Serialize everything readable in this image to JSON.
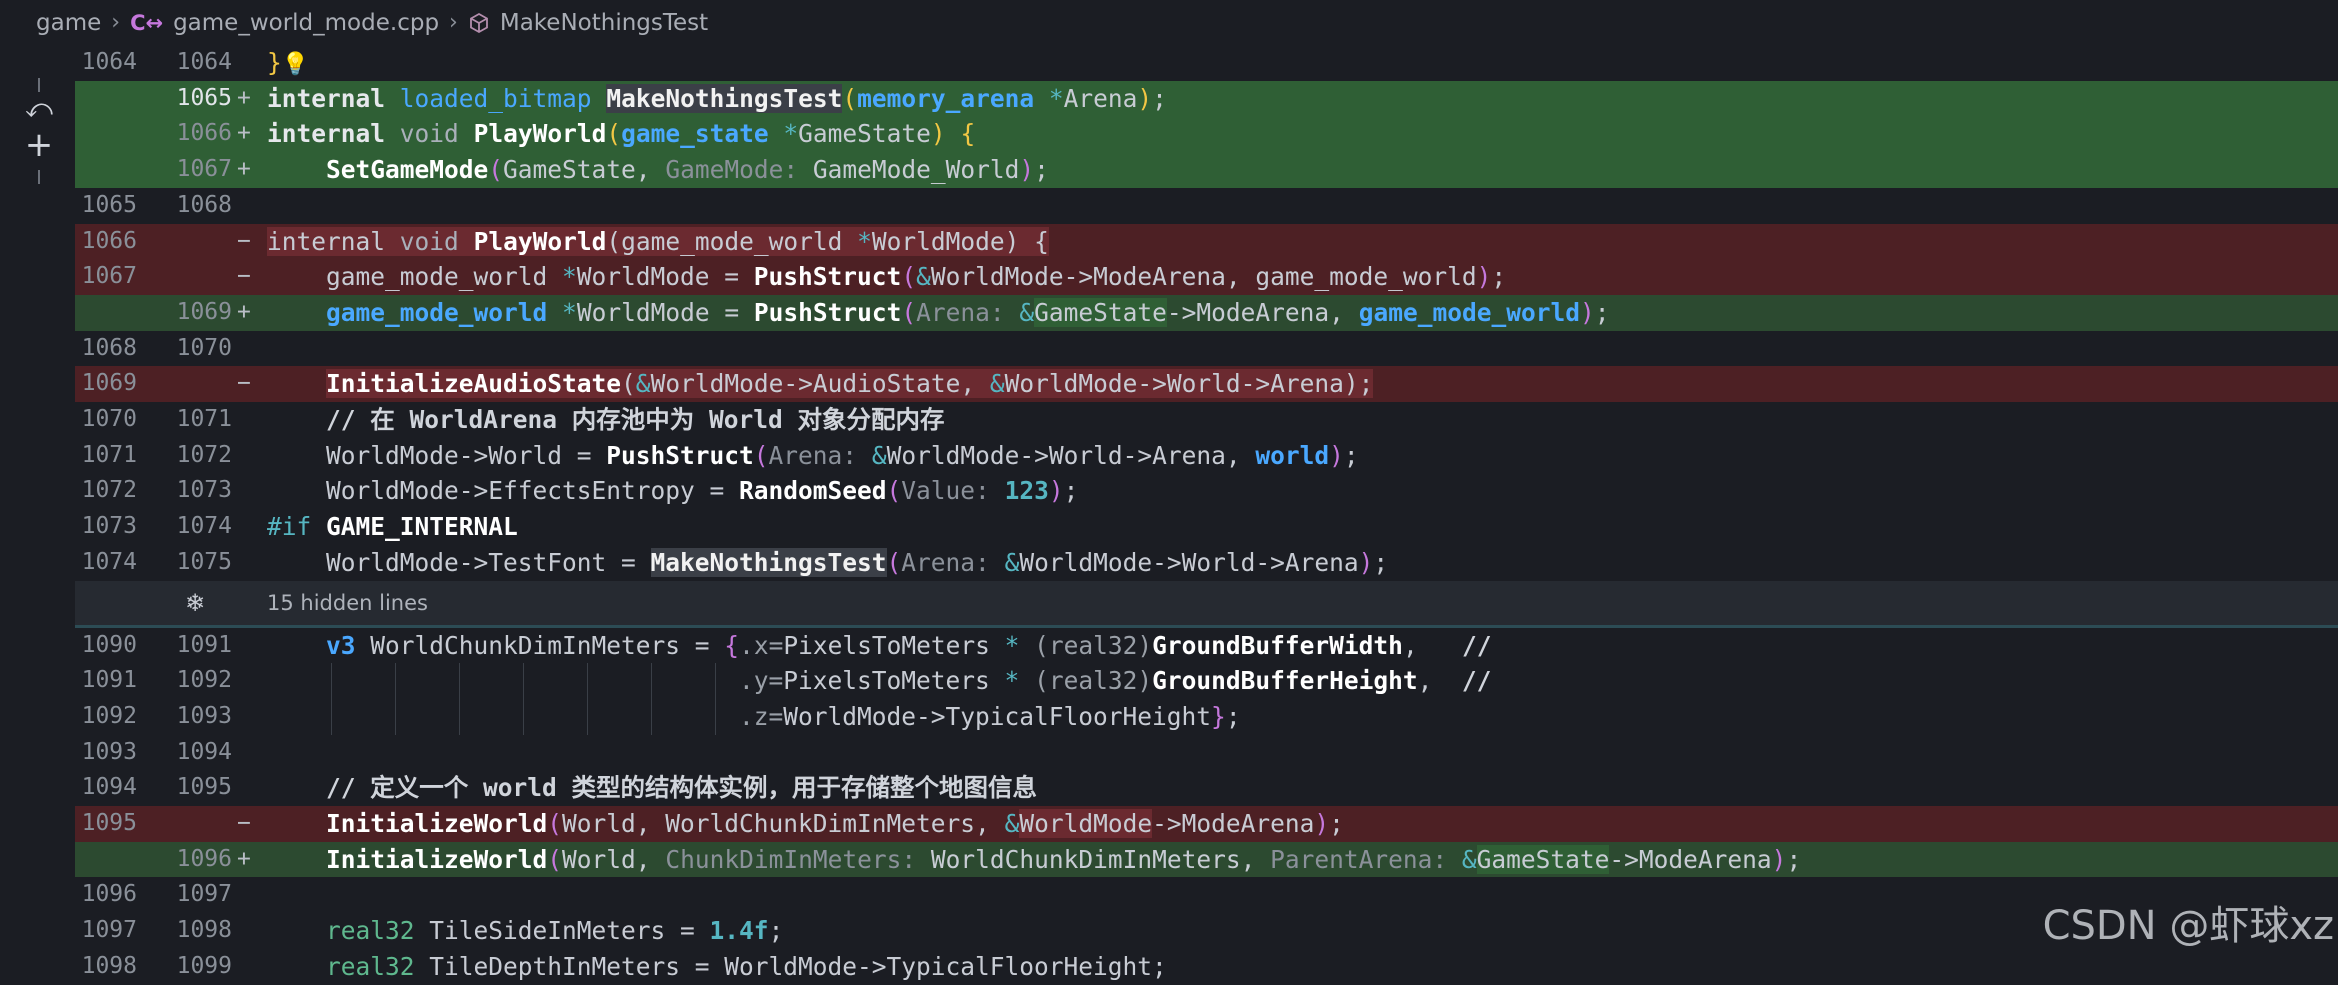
{
  "breadcrumb": {
    "root": "game",
    "file": "game_world_mode.cpp",
    "symbol": "MakeNothingsTest",
    "file_icon": "cpp-file-icon",
    "symbol_icon": "cube-icon"
  },
  "diff": {
    "hidden_lines_label": "15 hidden lines",
    "watermark": "CSDN @虾球xz",
    "lines": [
      {
        "old": "1064",
        "new": "1064",
        "mark": "",
        "text": "}"
      },
      {
        "old": "",
        "new": "1065",
        "mark": "+",
        "text": "internal loaded_bitmap MakeNothingsTest(memory_arena *Arena);"
      },
      {
        "old": "",
        "new": "1066",
        "mark": "+",
        "text": "internal void PlayWorld(game_state *GameState) {"
      },
      {
        "old": "",
        "new": "1067",
        "mark": "+",
        "text": "    SetGameMode(GameState, GameMode: GameMode_World);"
      },
      {
        "old": "1065",
        "new": "1068",
        "mark": "",
        "text": ""
      },
      {
        "old": "1066",
        "new": "",
        "mark": "−",
        "text": "internal void PlayWorld(game_mode_world *WorldMode) {"
      },
      {
        "old": "1067",
        "new": "",
        "mark": "−",
        "text": "    game_mode_world *WorldMode = PushStruct(&WorldMode->ModeArena, game_mode_world);"
      },
      {
        "old": "",
        "new": "1069",
        "mark": "+",
        "text": "    game_mode_world *WorldMode = PushStruct(Arena: &GameState->ModeArena, game_mode_world);"
      },
      {
        "old": "1068",
        "new": "1070",
        "mark": "",
        "text": ""
      },
      {
        "old": "1069",
        "new": "",
        "mark": "−",
        "text": "    InitializeAudioState(&WorldMode->AudioState, &WorldMode->World->Arena);"
      },
      {
        "old": "1070",
        "new": "1071",
        "mark": "",
        "text": "    // 在 WorldArena 内存池中为 World 对象分配内存"
      },
      {
        "old": "1071",
        "new": "1072",
        "mark": "",
        "text": "    WorldMode->World = PushStruct(Arena: &WorldMode->World->Arena, world);"
      },
      {
        "old": "1072",
        "new": "1073",
        "mark": "",
        "text": "    WorldMode->EffectsEntropy = RandomSeed(Value: 123);"
      },
      {
        "old": "1073",
        "new": "1074",
        "mark": "",
        "text": "#if GAME_INTERNAL"
      },
      {
        "old": "1074",
        "new": "1075",
        "mark": "",
        "text": "    WorldMode->TestFont = MakeNothingsTest(Arena: &WorldMode->World->Arena);"
      },
      {
        "old": "1090",
        "new": "1091",
        "mark": "",
        "text": "    v3 WorldChunkDimInMeters = {.x=PixelsToMeters * (real32)GroundBufferWidth,   //"
      },
      {
        "old": "1091",
        "new": "1092",
        "mark": "",
        "text": "                                .y=PixelsToMeters * (real32)GroundBufferHeight,  //"
      },
      {
        "old": "1092",
        "new": "1093",
        "mark": "",
        "text": "                                .z=WorldMode->TypicalFloorHeight};"
      },
      {
        "old": "1093",
        "new": "1094",
        "mark": "",
        "text": ""
      },
      {
        "old": "1094",
        "new": "1095",
        "mark": "",
        "text": "    // 定义一个 world 类型的结构体实例，用于存储整个地图信息"
      },
      {
        "old": "1095",
        "new": "",
        "mark": "−",
        "text": "    InitializeWorld(World, WorldChunkDimInMeters, &WorldMode->ModeArena);"
      },
      {
        "old": "",
        "new": "1096",
        "mark": "+",
        "text": "    InitializeWorld(World, ChunkDimInMeters: WorldChunkDimInMeters, ParentArena: &GameState->ModeArena);"
      },
      {
        "old": "1096",
        "new": "1097",
        "mark": "",
        "text": ""
      },
      {
        "old": "1097",
        "new": "1098",
        "mark": "",
        "text": "    real32 TileSideInMeters = 1.4f;"
      },
      {
        "old": "1098",
        "new": "1099",
        "mark": "",
        "text": "    real32 TileDepthInMeters = WorldMode->TypicalFloorHeight;"
      }
    ]
  }
}
